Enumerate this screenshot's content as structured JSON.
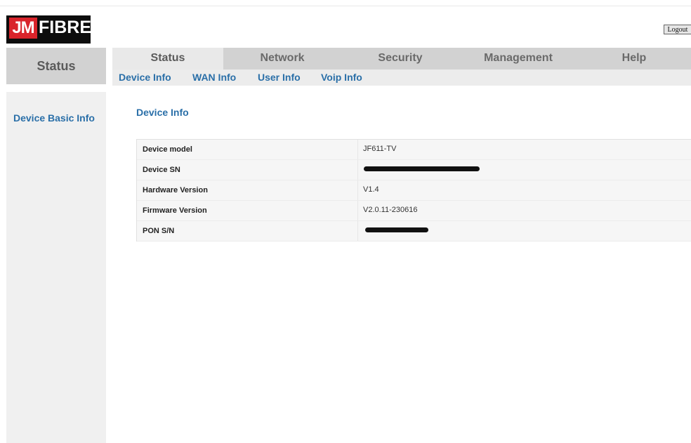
{
  "header": {
    "logo_mark": "JM",
    "logo_word": "FIBRE",
    "logout_label": "Logout"
  },
  "nav": {
    "section_title": "Status",
    "tabs": [
      {
        "label": "Status"
      },
      {
        "label": "Network"
      },
      {
        "label": "Security"
      },
      {
        "label": "Management"
      },
      {
        "label": "Help"
      }
    ],
    "subtabs": [
      {
        "label": "Device Info"
      },
      {
        "label": "WAN Info"
      },
      {
        "label": "User Info"
      },
      {
        "label": "Voip Info"
      }
    ]
  },
  "sidebar": {
    "items": [
      {
        "label": "Device Basic Info"
      }
    ]
  },
  "main": {
    "title": "Device Info",
    "rows": [
      {
        "key": "Device model",
        "value": "JF611-TV"
      },
      {
        "key": "Device SN",
        "value": ""
      },
      {
        "key": "Hardware Version",
        "value": "V1.4"
      },
      {
        "key": "Firmware Version",
        "value": "V2.0.11-230616"
      },
      {
        "key": "PON S/N",
        "value": ""
      }
    ]
  },
  "colors": {
    "link_blue": "#2a6fa8",
    "nav_gray": "#d2d2d2",
    "logo_red": "#d9242b"
  }
}
